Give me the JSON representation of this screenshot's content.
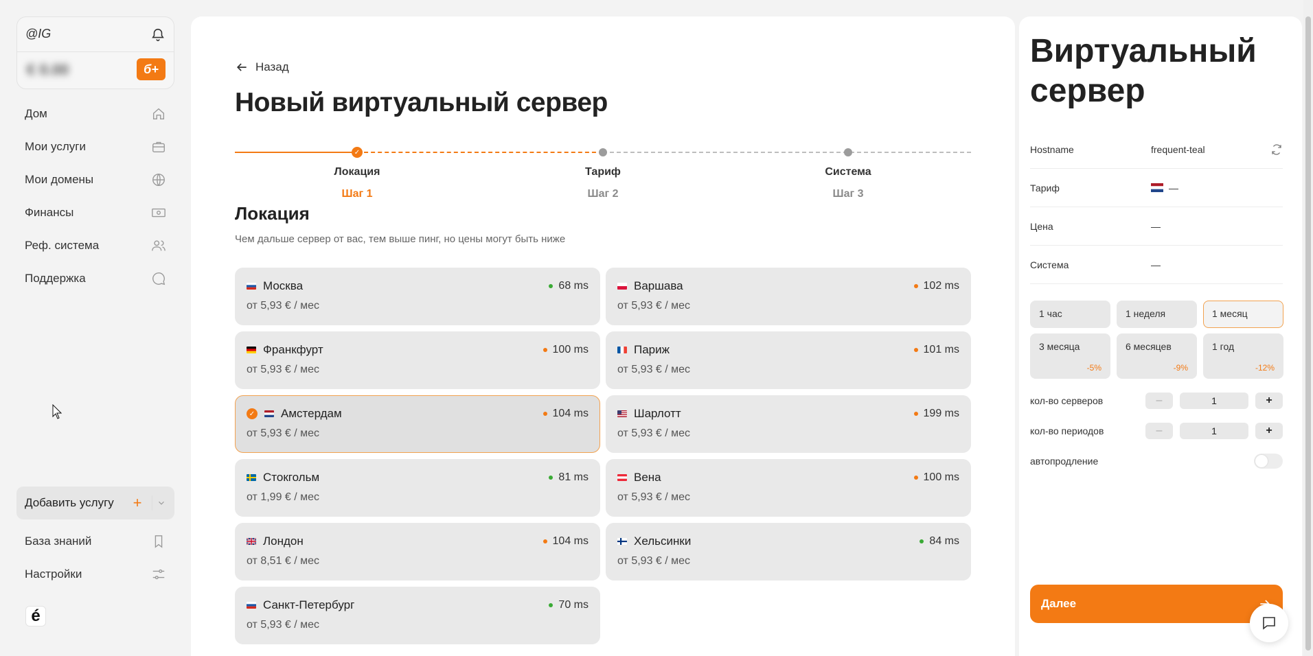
{
  "account": {
    "name": "@IG",
    "balance": "€ 0.00",
    "badge": "б+"
  },
  "nav": [
    {
      "label": "Дом",
      "icon": "home-icon"
    },
    {
      "label": "Мои услуги",
      "icon": "briefcase-icon"
    },
    {
      "label": "Мои домены",
      "icon": "globe-icon"
    },
    {
      "label": "Финансы",
      "icon": "banknote-icon"
    },
    {
      "label": "Реф. система",
      "icon": "users-icon"
    },
    {
      "label": "Поддержка",
      "icon": "chat-icon"
    }
  ],
  "add_service": {
    "label": "Добавить услугу",
    "plus": "+"
  },
  "nav_bottom": [
    {
      "label": "База знаний",
      "icon": "bookmark-icon"
    },
    {
      "label": "Настройки",
      "icon": "sliders-icon"
    }
  ],
  "logo": "é",
  "main": {
    "back": "Назад",
    "title": "Новый виртуальный сервер",
    "steps": [
      {
        "label": "Локация",
        "num": "Шаг 1"
      },
      {
        "label": "Тариф",
        "num": "Шаг 2"
      },
      {
        "label": "Система",
        "num": "Шаг 3"
      }
    ],
    "section_title": "Локация",
    "section_sub": "Чем дальше сервер от вас, тем выше пинг, но цены могут быть ниже",
    "locations": [
      {
        "name": "Москва",
        "ping": "68 ms",
        "price": "от 5,93 € / мес",
        "flag": "ru",
        "ping_color": "#3aaa35"
      },
      {
        "name": "Варшава",
        "ping": "102 ms",
        "price": "от 5,93 € / мес",
        "flag": "pl",
        "ping_color": "#f37a14"
      },
      {
        "name": "Франкфурт",
        "ping": "100 ms",
        "price": "от 5,93 € / мес",
        "flag": "de",
        "ping_color": "#f37a14"
      },
      {
        "name": "Париж",
        "ping": "101 ms",
        "price": "от 5,93 € / мес",
        "flag": "fr",
        "ping_color": "#f37a14"
      },
      {
        "name": "Амстердам",
        "ping": "104 ms",
        "price": "от 5,93 € / мес",
        "flag": "nl",
        "ping_color": "#f37a14",
        "selected": true
      },
      {
        "name": "Шарлотт",
        "ping": "199 ms",
        "price": "от 5,93 € / мес",
        "flag": "us",
        "ping_color": "#f37a14"
      },
      {
        "name": "Стокгольм",
        "ping": "81 ms",
        "price": "от 1,99 € / мес",
        "flag": "se",
        "ping_color": "#3aaa35"
      },
      {
        "name": "Вена",
        "ping": "100 ms",
        "price": "от 5,93 € / мес",
        "flag": "at",
        "ping_color": "#f37a14"
      },
      {
        "name": "Лондон",
        "ping": "104 ms",
        "price": "от 8,51 € / мес",
        "flag": "gb",
        "ping_color": "#f37a14"
      },
      {
        "name": "Хельсинки",
        "ping": "84 ms",
        "price": "от 5,93 € / мес",
        "flag": "fi",
        "ping_color": "#3aaa35"
      },
      {
        "name": "Санкт-Петербург",
        "ping": "70 ms",
        "price": "от 5,93 € / мес",
        "flag": "ru",
        "ping_color": "#3aaa35"
      }
    ]
  },
  "summary": {
    "title": "Виртуальный сервер",
    "rows": [
      {
        "key": "Hostname",
        "value": "frequent-teal"
      },
      {
        "key": "Тариф",
        "value": "—"
      },
      {
        "key": "Цена",
        "value": "—"
      },
      {
        "key": "Система",
        "value": "—"
      }
    ],
    "periods": [
      {
        "label": "1 час",
        "discount": ""
      },
      {
        "label": "1 неделя",
        "discount": ""
      },
      {
        "label": "1 месяц",
        "discount": "",
        "selected": true
      },
      {
        "label": "3 месяца",
        "discount": "-5%"
      },
      {
        "label": "6 месяцев",
        "discount": "-9%"
      },
      {
        "label": "1 год",
        "discount": "-12%"
      }
    ],
    "servers_label": "кол-во серверов",
    "servers_value": "1",
    "periods_label": "кол-во периодов",
    "periods_value": "1",
    "autorenew_label": "автопродление",
    "minus": "–",
    "plus": "+",
    "next": "Далее"
  },
  "colors": {
    "accent": "#f37a14",
    "ping_good": "#3aaa35"
  }
}
